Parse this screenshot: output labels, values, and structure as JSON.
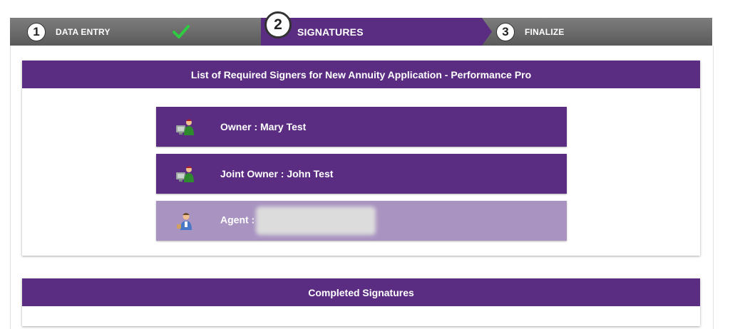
{
  "stepper": {
    "steps": [
      {
        "number": "1",
        "label": "DATA ENTRY"
      },
      {
        "number": "2",
        "label": "SIGNATURES"
      },
      {
        "number": "3",
        "label": "FINALIZE"
      }
    ],
    "active_color": "#5b2d82",
    "completed_icon": "checkmark-icon"
  },
  "required_signers": {
    "title": "List of Required Signers for New Annuity Application - Performance Pro",
    "signers": [
      {
        "label": "Owner : Mary Test",
        "icon": "person-computer-icon",
        "state": "active"
      },
      {
        "label": "Joint Owner : John Test",
        "icon": "person-computer-icon",
        "state": "active"
      },
      {
        "label": "Agent :",
        "icon": "agent-icon",
        "state": "disabled"
      }
    ]
  },
  "completed": {
    "title": "Completed Signatures"
  }
}
